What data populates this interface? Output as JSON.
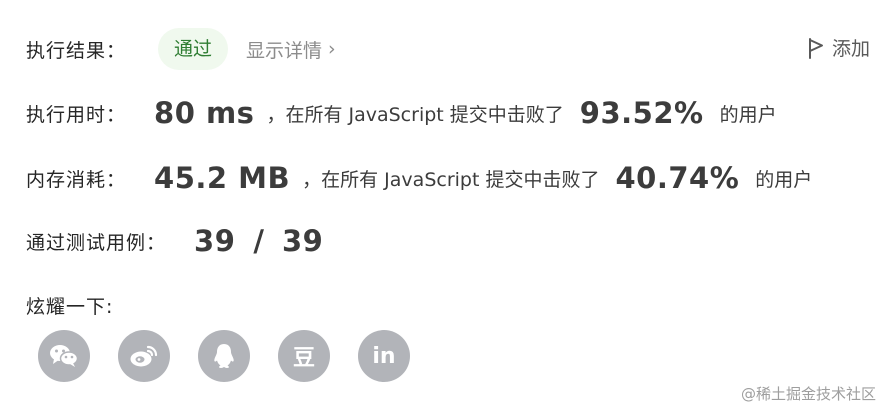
{
  "result": {
    "label": "执行结果：",
    "status": "通过",
    "detail_link": "显示详情",
    "chevron": "›",
    "add_note": "添加"
  },
  "runtime": {
    "label": "执行用时：",
    "value": "80 ms",
    "phrase": "，在所有 JavaScript 提交中击败了",
    "percent": "93.52%",
    "suffix": "的用户"
  },
  "memory": {
    "label": "内存消耗：",
    "value": "45.2 MB",
    "phrase": "，在所有 JavaScript 提交中击败了",
    "percent": "40.74%",
    "suffix": "的用户"
  },
  "testcases": {
    "label": "通过测试用例：",
    "passed": "39",
    "separator": "/",
    "total": "39"
  },
  "share": {
    "label": "炫耀一下:",
    "icons": [
      {
        "name": "wechat-icon"
      },
      {
        "name": "weibo-icon"
      },
      {
        "name": "qq-icon"
      },
      {
        "name": "douban-icon",
        "glyph": "豆"
      },
      {
        "name": "linkedin-icon",
        "glyph": "in"
      }
    ]
  },
  "watermark": "@稀土掘金技术社区",
  "colors": {
    "status_bg": "#f0f9ee",
    "status_text": "#2e7d32",
    "icon_bg": "#b2b4b9",
    "muted_text": "#8c8c8c"
  }
}
